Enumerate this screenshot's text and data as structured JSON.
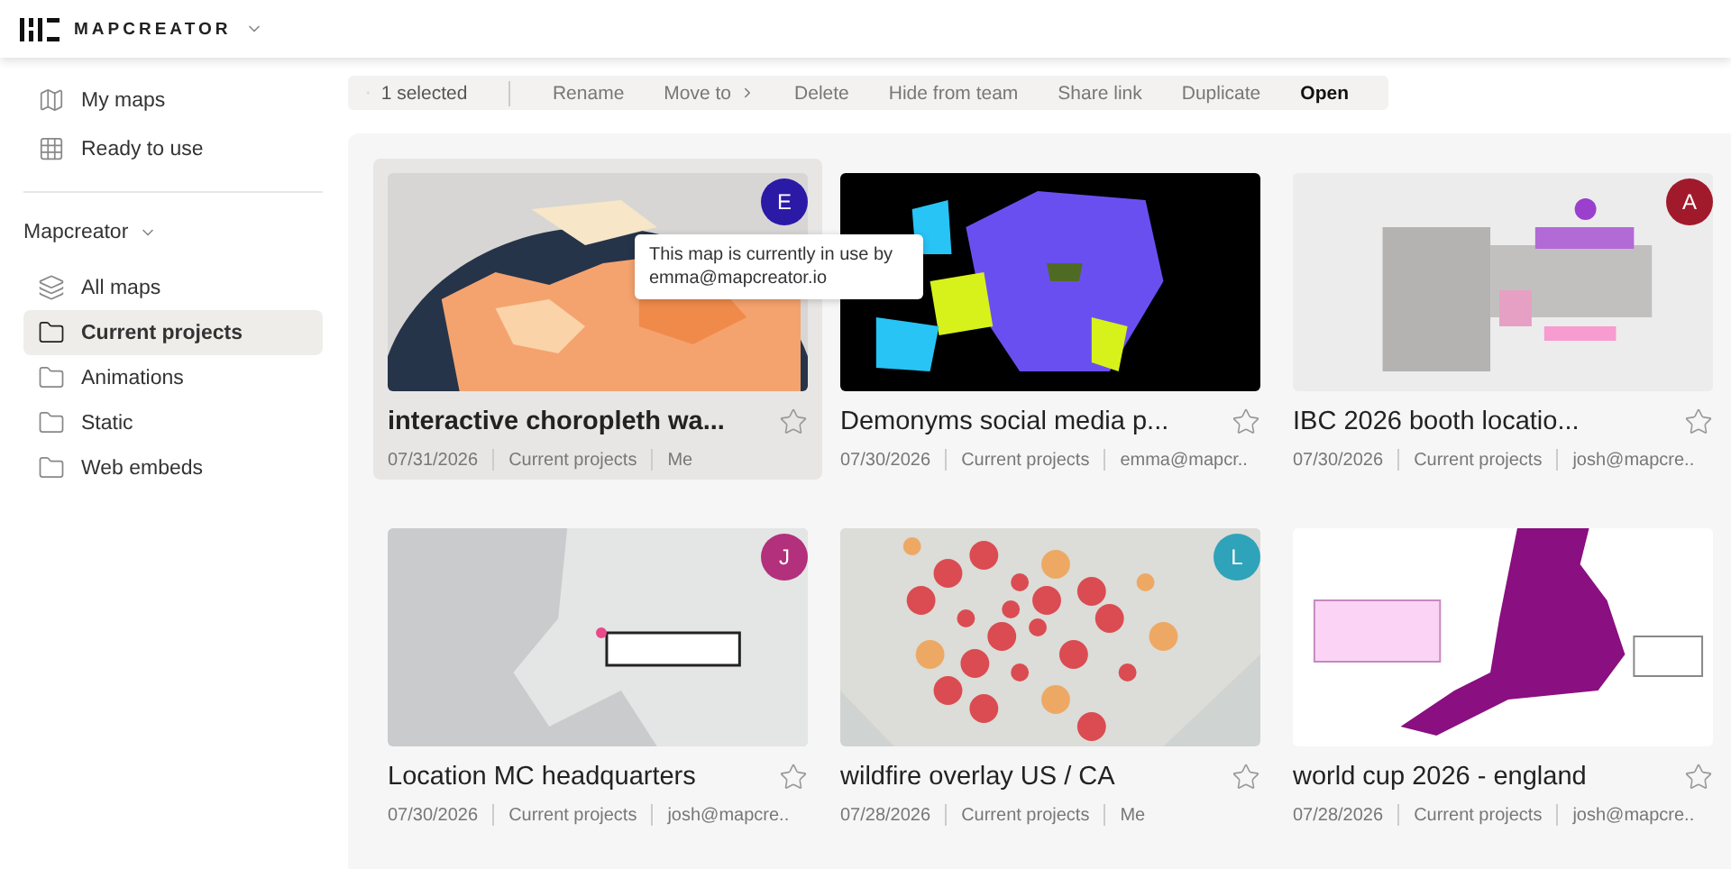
{
  "header": {
    "brand": "MAPCREATOR"
  },
  "sidebar": {
    "top_items": [
      {
        "label": "My maps",
        "kind": "map",
        "selected": false
      },
      {
        "label": "Ready to use",
        "kind": "grid",
        "selected": false
      }
    ],
    "workspace": "Mapcreator",
    "folders": [
      {
        "label": "All maps",
        "kind": "stack",
        "selected": false
      },
      {
        "label": "Current projects",
        "kind": "folder",
        "selected": true
      },
      {
        "label": "Animations",
        "kind": "folder",
        "selected": false
      },
      {
        "label": "Static",
        "kind": "folder",
        "selected": false
      },
      {
        "label": "Web embeds",
        "kind": "folder",
        "selected": false
      }
    ]
  },
  "toolbar": {
    "selection": "1 selected",
    "actions": [
      {
        "label": "Rename",
        "kind": "plain"
      },
      {
        "label": "Move to",
        "kind": "submenu"
      },
      {
        "label": "Delete",
        "kind": "plain"
      },
      {
        "label": "Hide from team",
        "kind": "plain"
      },
      {
        "label": "Share link",
        "kind": "plain"
      },
      {
        "label": "Duplicate",
        "kind": "plain"
      },
      {
        "label": "Open",
        "kind": "primary"
      }
    ]
  },
  "cards": [
    {
      "title": "interactive choropleth wa...",
      "date": "07/31/2026",
      "folder": "Current projects",
      "owner": "Me",
      "selected": true,
      "avatar": {
        "letter": "E",
        "color": "#2b1aa6"
      },
      "tooltip": "This map is currently in use by emma@mapcreator.io"
    },
    {
      "title": "Demonyms social media p...",
      "date": "07/30/2026",
      "folder": "Current projects",
      "owner": "emma@mapcr..",
      "selected": false
    },
    {
      "title": "IBC 2026 booth locatio...",
      "date": "07/30/2026",
      "folder": "Current projects",
      "owner": "josh@mapcre..",
      "selected": false,
      "avatar": {
        "letter": "A",
        "color": "#a11a2c"
      }
    },
    {
      "title": "Location MC headquarters",
      "date": "07/30/2026",
      "folder": "Current projects",
      "owner": "josh@mapcre..",
      "selected": false,
      "avatar": {
        "letter": "J",
        "color": "#b3307c"
      }
    },
    {
      "title": "wildfire overlay US / CA",
      "date": "07/28/2026",
      "folder": "Current projects",
      "owner": "Me",
      "selected": false,
      "avatar": {
        "letter": "L",
        "color": "#2fa3b9"
      }
    },
    {
      "title": "world cup 2026 - england",
      "date": "07/28/2026",
      "folder": "Current projects",
      "owner": "josh@mapcre..",
      "selected": false
    }
  ]
}
